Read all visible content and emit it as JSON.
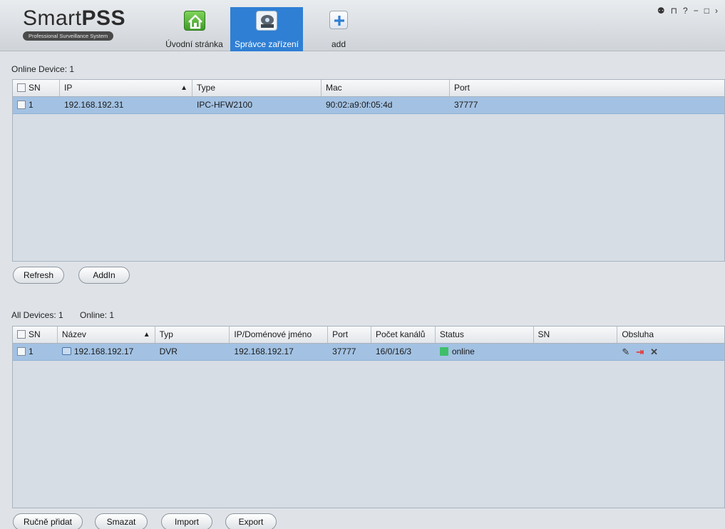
{
  "app": {
    "logo_title_light": "Smart",
    "logo_title_bold": "PSS",
    "logo_subtitle": "Professional Surveillance System"
  },
  "nav": {
    "home": "Úvodní stránka",
    "device_manager": "Správce zařízení",
    "add": "add"
  },
  "window_controls": [
    "user-icon",
    "lock-icon",
    "help-icon",
    "minimize-icon",
    "maximize-icon",
    "close-icon"
  ],
  "online": {
    "label": "Online Device: 1",
    "columns": [
      "SN",
      "IP",
      "Type",
      "Mac",
      "Port"
    ],
    "rows": [
      {
        "sn": "1",
        "ip": "192.168.192.31",
        "type": "IPC-HFW2100",
        "mac": "90:02:a9:0f:05:4d",
        "port": "37777"
      }
    ],
    "buttons": {
      "refresh": "Refresh",
      "addin": "AddIn"
    }
  },
  "all": {
    "label": "All Devices: 1",
    "online_label": "Online: 1",
    "columns": [
      "SN",
      "Název",
      "Typ",
      "IP/Doménové jméno",
      "Port",
      "Počet kanálů",
      "Status",
      "SN",
      "Obsluha"
    ],
    "rows": [
      {
        "sn": "1",
        "name": "192.168.192.17",
        "type": "DVR",
        "ip": "192.168.192.17",
        "port": "37777",
        "channels": "16/0/16/3",
        "status": "online",
        "serial": ""
      }
    ],
    "buttons": {
      "manual_add": "Ručně přidat",
      "delete": "Smazat",
      "import": "Import",
      "export": "Export"
    }
  },
  "colors": {
    "accent": "#2f7fd4",
    "selected_row": "#a3c2e3",
    "online_status": "#3fbf6a"
  }
}
